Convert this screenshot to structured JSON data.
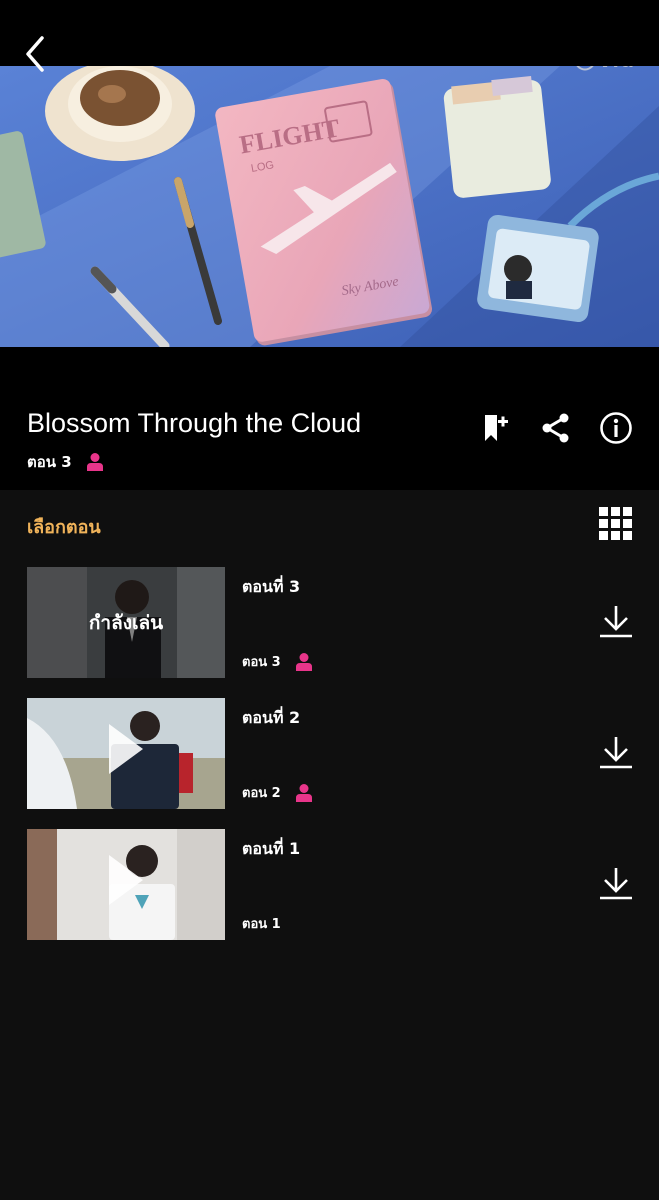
{
  "header": {
    "back_icon": "chevron-left-icon",
    "logo_text": "viu"
  },
  "show": {
    "title": "Blossom Through the Cloud",
    "current_episode": "ตอน 3",
    "actions": [
      "bookmark-add-icon",
      "share-icon",
      "info-icon"
    ]
  },
  "episodes_section": {
    "label": "เลือกตอน",
    "grid_icon": "grid-icon"
  },
  "episodes": [
    {
      "title": "ตอนที่ 3",
      "sub": "ตอน 3",
      "overlay": "กำลังเล่น",
      "has_user_badge": true
    },
    {
      "title": "ตอนที่ 2",
      "sub": "ตอน 2",
      "has_user_badge": true
    },
    {
      "title": "ตอนที่ 1",
      "sub": "ตอน 1",
      "has_user_badge": false
    }
  ],
  "colors": {
    "accent_label": "#f0b35a",
    "user_badge": "#e8358a",
    "background": "#0f0f0f",
    "header_bg": "#000000"
  }
}
